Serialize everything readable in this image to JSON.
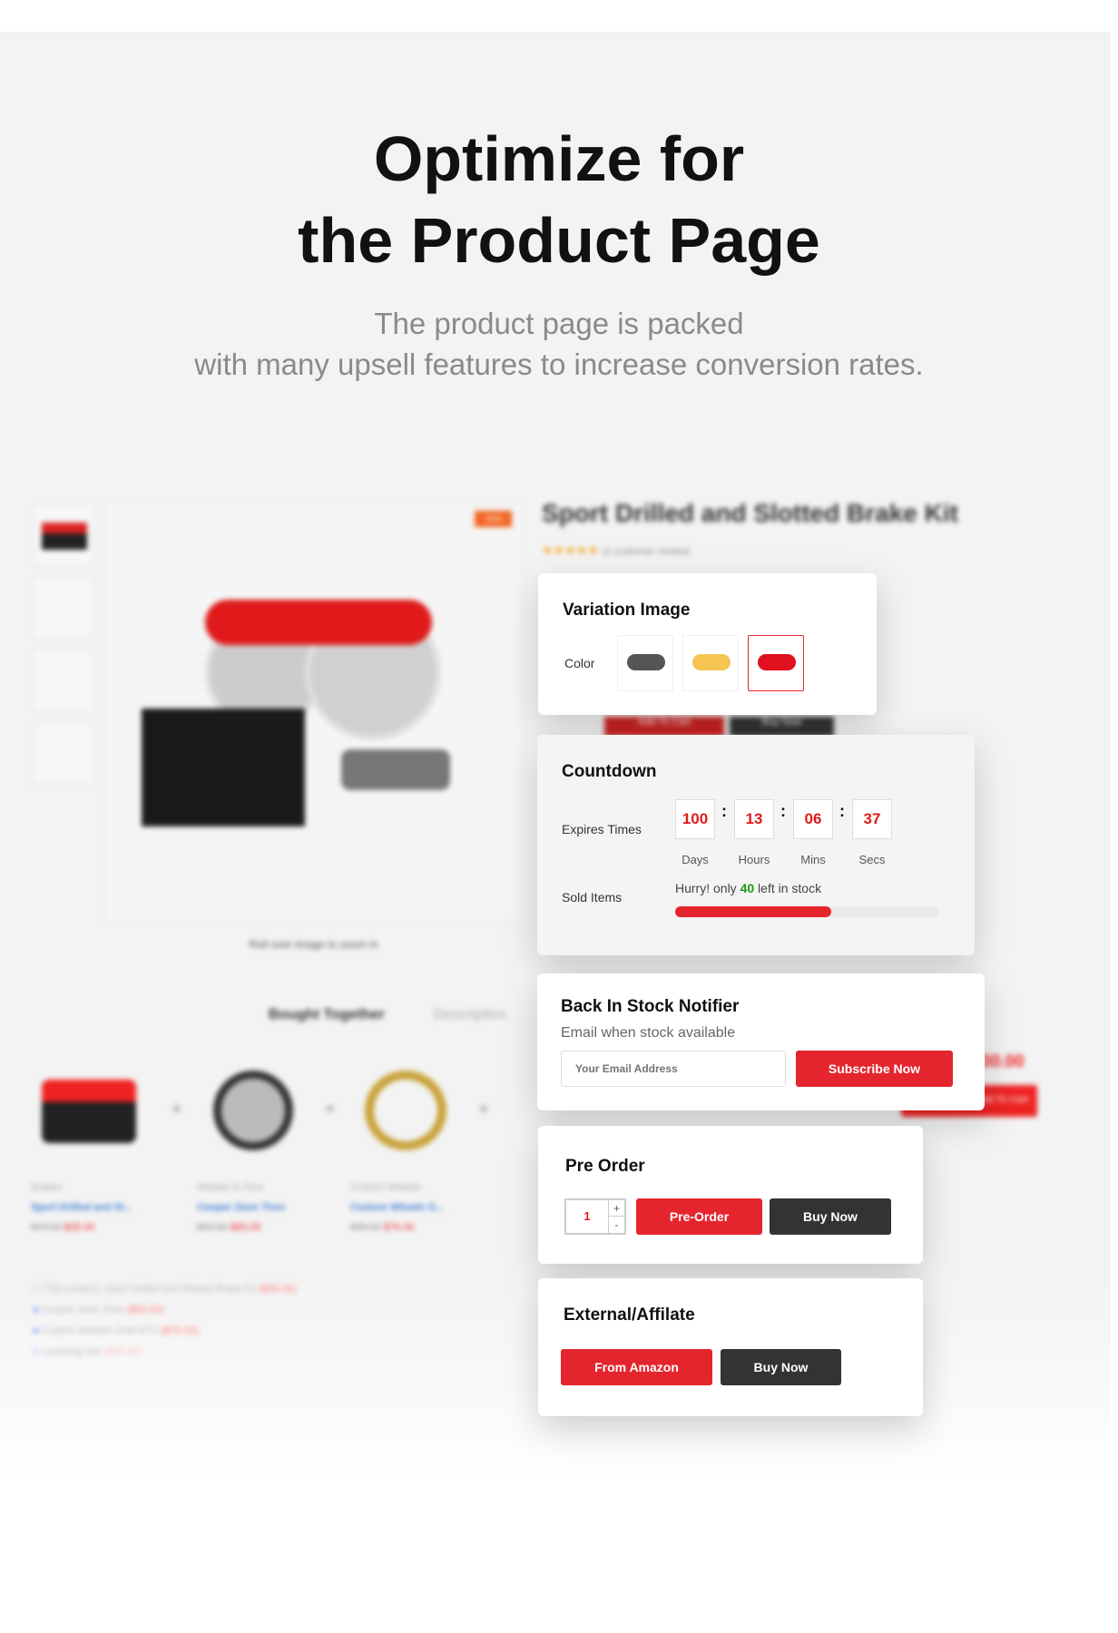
{
  "hero": {
    "title_line1": "Optimize for",
    "title_line2": "the Product Page",
    "subtitle_line1": "The product page is packed",
    "subtitle_line2": "with many upsell features to increase conversion rates."
  },
  "background_page": {
    "product_title": "Sport Drilled and Slotted Brake Kit",
    "rating": 5,
    "reviews": "(1 customer review)",
    "sale_badge": "-50%",
    "zoom_hint": "Roll over image to zoom in",
    "tabs": [
      "Bought Together",
      "Description"
    ],
    "bought_items": [
      {
        "category": "Brakes",
        "name": "Sport Drilled and Sl...",
        "old_price": "$70.00",
        "price": "$35.00"
      },
      {
        "category": "Wheels & Tires",
        "name": "Cooper Zeon Tires",
        "old_price": "$90.00",
        "price": "$65.00"
      },
      {
        "category": "Custom Wheels",
        "name": "Custom Wheels G...",
        "old_price": "$95.00",
        "price": "$75.00"
      }
    ],
    "checklist": [
      {
        "label": "This product: Sport Drilled and Slotted Brake Kit",
        "price": "($35.00)"
      },
      {
        "label": "Cooper Zeon Tires",
        "price": "($65.00)"
      },
      {
        "label": "Custom Wheels Gold RTX",
        "price": "($75.00)"
      },
      {
        "label": "Lowering Kits",
        "price": "($55.00)"
      }
    ],
    "total": "$230.00",
    "add_to_cart": "Add To Cart",
    "buy_now": "Buy Now",
    "cart_button": "Add To Cart"
  },
  "variation": {
    "title": "Variation Image",
    "label": "Color",
    "swatches": [
      {
        "name": "gray",
        "color": "#555555"
      },
      {
        "name": "yellow",
        "color": "#f6c451"
      },
      {
        "name": "red",
        "color": "#e0101e",
        "selected": true
      }
    ]
  },
  "countdown": {
    "title": "Countdown",
    "expires_label": "Expires Times",
    "days": "100",
    "hours": "13",
    "mins": "06",
    "secs": "37",
    "units": [
      "Days",
      "Hours",
      "Mins",
      "Secs"
    ],
    "sold_label": "Sold Items",
    "hurry_prefix": "Hurry! only",
    "stock_count": "40",
    "hurry_suffix": "left in stock",
    "sold_fraction": 0.59
  },
  "back_in_stock": {
    "title": "Back In Stock Notifier",
    "subtitle": "Email when stock available",
    "email_placeholder": "Your Email Address",
    "subscribe": "Subscribe Now"
  },
  "pre_order": {
    "title": "Pre Order",
    "qty": "1",
    "plus": "+",
    "minus": "-",
    "preorder": "Pre-Order",
    "buy_now": "Buy Now"
  },
  "external": {
    "title": "External/Affilate",
    "amazon": "From Amazon",
    "buy_now": "Buy Now"
  },
  "colors": {
    "accent": "#e5252e",
    "dark": "#333333",
    "green": "#1a9a1a",
    "background": "#f3f3f3"
  }
}
